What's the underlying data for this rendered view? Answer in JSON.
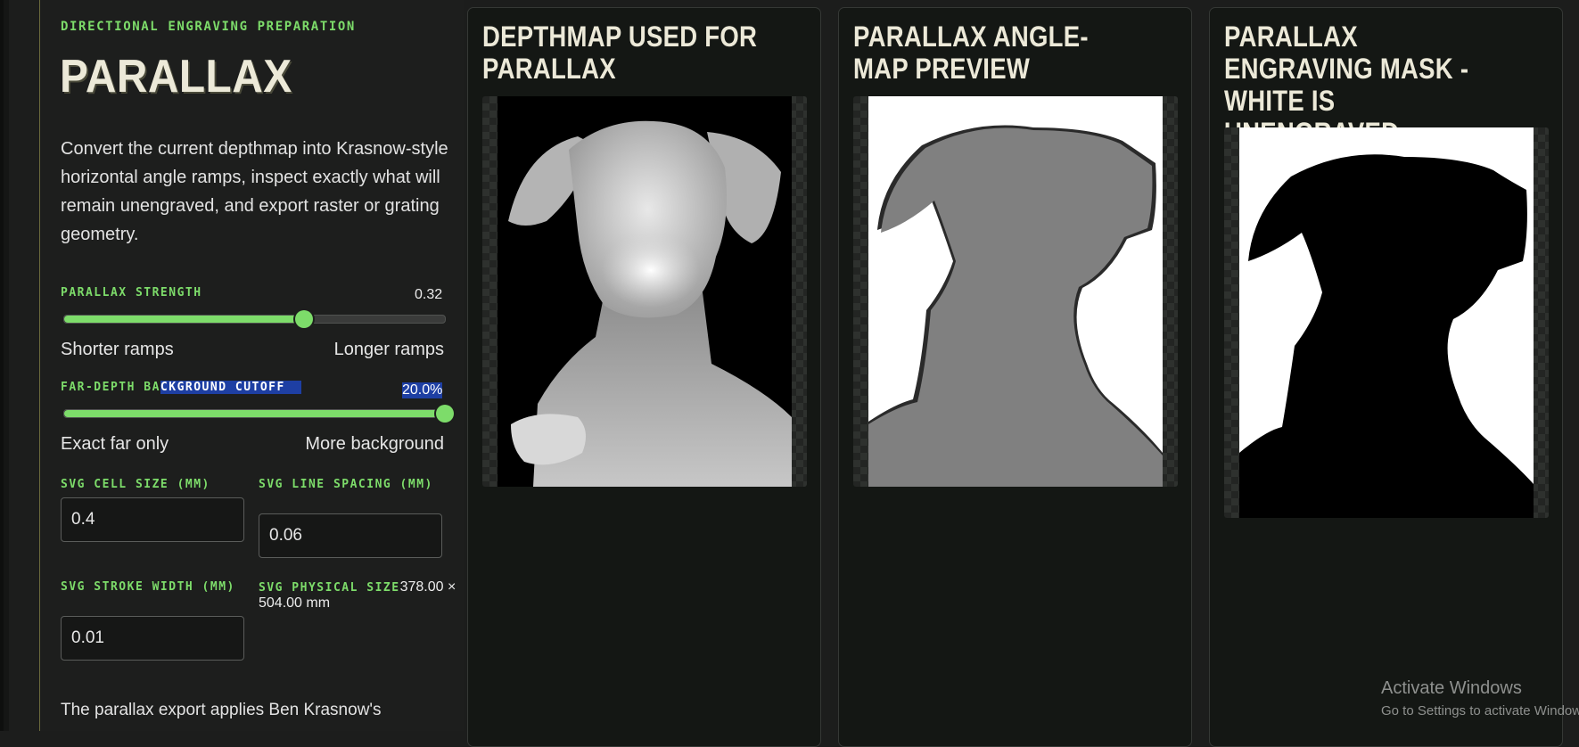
{
  "sidebar": {
    "eyebrow": "DIRECTIONAL ENGRAVING PREPARATION",
    "title": "PARALLAX",
    "description": "Convert the current depthmap into Krasnow-style horizontal angle ramps, inspect exactly what will remain unengraved, and export raster or grating geometry.",
    "parallax_strength": {
      "label": "PARALLAX STRENGTH",
      "value_text": "0.32",
      "fraction": 0.63,
      "min_label": "Shorter ramps",
      "max_label": "Longer ramps"
    },
    "cutoff": {
      "label_a": "FAR-DEPTH BA",
      "label_b": "CKGROUND CUTOFF",
      "value_text": "20.0%",
      "fraction": 1.0,
      "min_label": "Exact far only",
      "max_label": "More background"
    },
    "svg_cell_size": {
      "label": "SVG CELL SIZE (MM)",
      "value": "0.4"
    },
    "svg_line_spacing": {
      "label": "SVG LINE SPACING (MM)",
      "value": "0.06"
    },
    "svg_stroke_width": {
      "label": "SVG STROKE WIDTH (MM)",
      "value": "0.01"
    },
    "svg_physical_size": {
      "label": "SVG PHYSICAL SIZE",
      "value": "378.00 × 504.00 mm"
    },
    "footer_text": "The parallax export applies Ben Krasnow's"
  },
  "panels": [
    {
      "title": "DEPTHMAP USED FOR PARALLAX",
      "image": "depthmap-dog"
    },
    {
      "title": "PARALLAX ANGLE-MAP PREVIEW",
      "image": "angle-map-dog"
    },
    {
      "title": "PARALLAX ENGRAVING MASK - WHITE IS UNENGRAVED",
      "image": "mask-dog"
    }
  ],
  "watermark": {
    "line1": "Activate Windows",
    "line2": "Go to Settings to activate Windows."
  },
  "colors": {
    "accent": "#7ddc6a",
    "background": "#1c1d1c",
    "panel_bg": "#141714",
    "selection": "#1e3fa3"
  }
}
